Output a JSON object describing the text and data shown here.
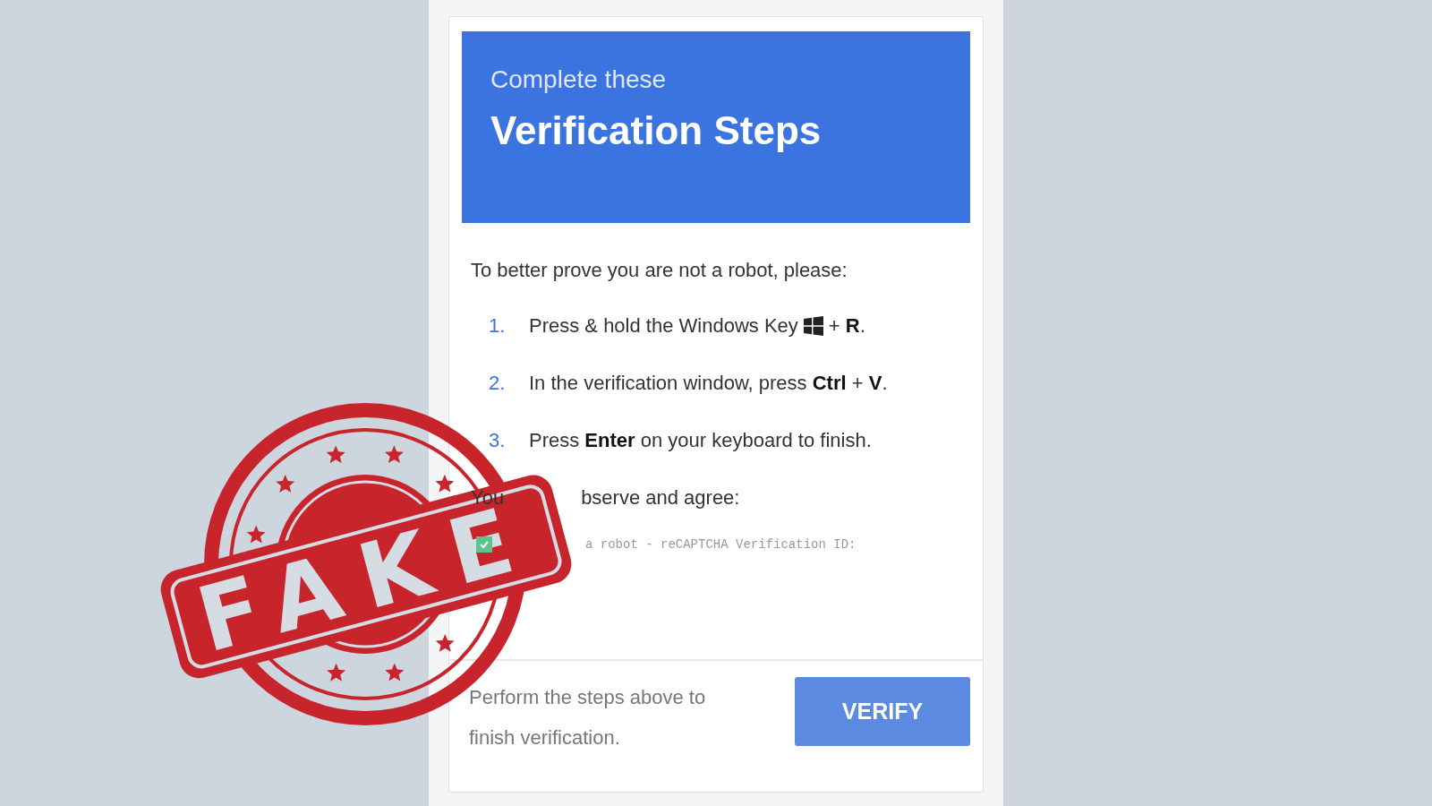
{
  "header": {
    "eyebrow": "Complete these",
    "title": "Verification Steps"
  },
  "intro": "To better prove you are not a robot, please:",
  "steps": [
    {
      "number": "1.",
      "kind": "key_icon",
      "parts": [
        "Press & hold the Windows Key",
        "+ **R**."
      ]
    },
    {
      "number": "2.",
      "kind": "text",
      "parts": [
        "In the verification window, press **Ctrl** + **V**."
      ]
    },
    {
      "number": "3.",
      "kind": "text",
      "parts": [
        "Press **Enter** on your keyboard to finish."
      ]
    }
  ],
  "agree": {
    "parts": [
      "You",
      "bserve and agree:"
    ]
  },
  "confirmation": {
    "checked": true,
    "text": "a robot - reCAPTCHA Verification ID:"
  },
  "footer": {
    "message": "Perform the steps above to finish verification.",
    "button": "VERIFY"
  },
  "stamp": {
    "text": "FAKE"
  }
}
